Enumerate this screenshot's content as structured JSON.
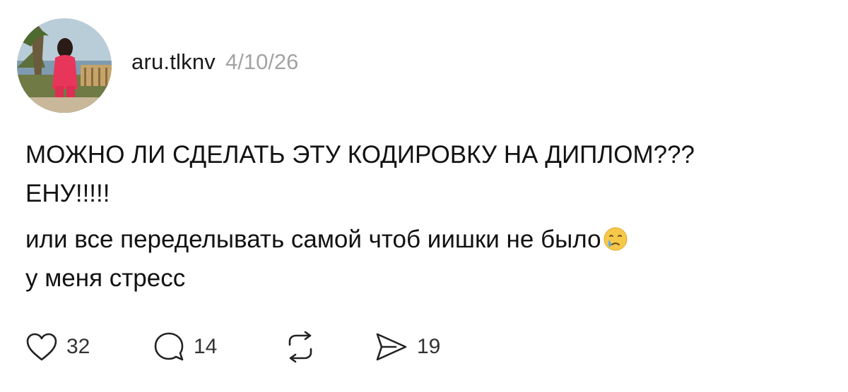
{
  "post": {
    "username": "aru.tlknv",
    "date": "4/10/26",
    "lines": [
      "МОЖНО ЛИ СДЕЛАТЬ ЭТУ КОДИРОВКУ НА ДИПЛОМ???",
      "ЕНУ!!!!!",
      "или все переделывать самой чтоб иишки не было",
      "у меня стресс"
    ],
    "emoji": "crying-face-emoji"
  },
  "actions": {
    "likes": "32",
    "comments": "14",
    "shares": "19"
  },
  "icons": {
    "like": "heart-icon",
    "comment": "comment-bubble-icon",
    "repost": "repost-icon",
    "share": "send-icon"
  },
  "colors": {
    "text": "#121212",
    "muted": "#a3a3a3",
    "icon": "#222222",
    "emoji_face": "#f6c84a",
    "emoji_tear": "#5aa9e6"
  }
}
